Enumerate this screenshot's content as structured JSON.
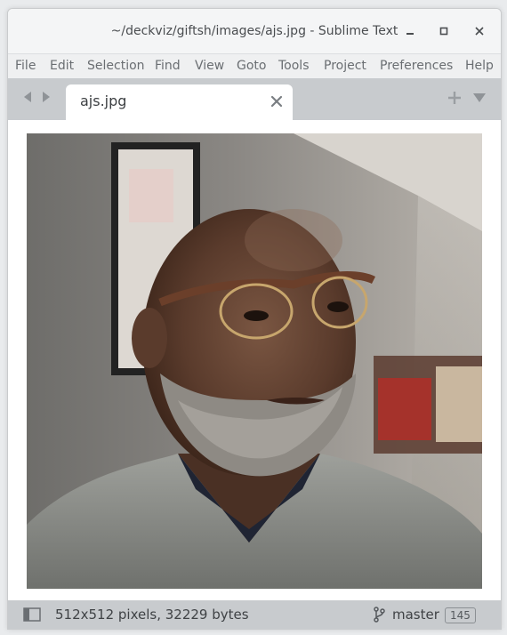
{
  "window": {
    "title": "~/deckviz/giftsh/images/ajs.jpg - Sublime Text",
    "controls": {
      "minimize": "minimize-icon",
      "maximize": "maximize-icon",
      "close": "close-icon"
    }
  },
  "menu": {
    "items": [
      "File",
      "Edit",
      "Selection",
      "Find",
      "View",
      "Goto",
      "Tools",
      "Project",
      "Preferences",
      "Help"
    ]
  },
  "tabs": {
    "nav": {
      "back": "left-arrow-icon",
      "forward": "right-arrow-icon"
    },
    "items": [
      {
        "label": "ajs.jpg",
        "active": true,
        "close_icon": "close-icon"
      }
    ],
    "new_tab_icon": "plus-icon",
    "tab_menu_icon": "chevron-down-icon"
  },
  "content": {
    "image": {
      "description_icon": "portrait-photo",
      "colors": {
        "background": "#7d7a75",
        "sweater": "#8a8c88",
        "skin": "#5b4033"
      }
    }
  },
  "status": {
    "sidebar_icon": "sidebar-toggle-icon",
    "info": "512x512 pixels, 32229 bytes",
    "branch_icon": "git-branch-icon",
    "branch": "master",
    "count": "145"
  },
  "colors": {
    "chrome": "#f4f5f6",
    "tabbar": "#c8cbce",
    "statusbar": "#c8cbce",
    "menu_text": "#6a6e72"
  }
}
